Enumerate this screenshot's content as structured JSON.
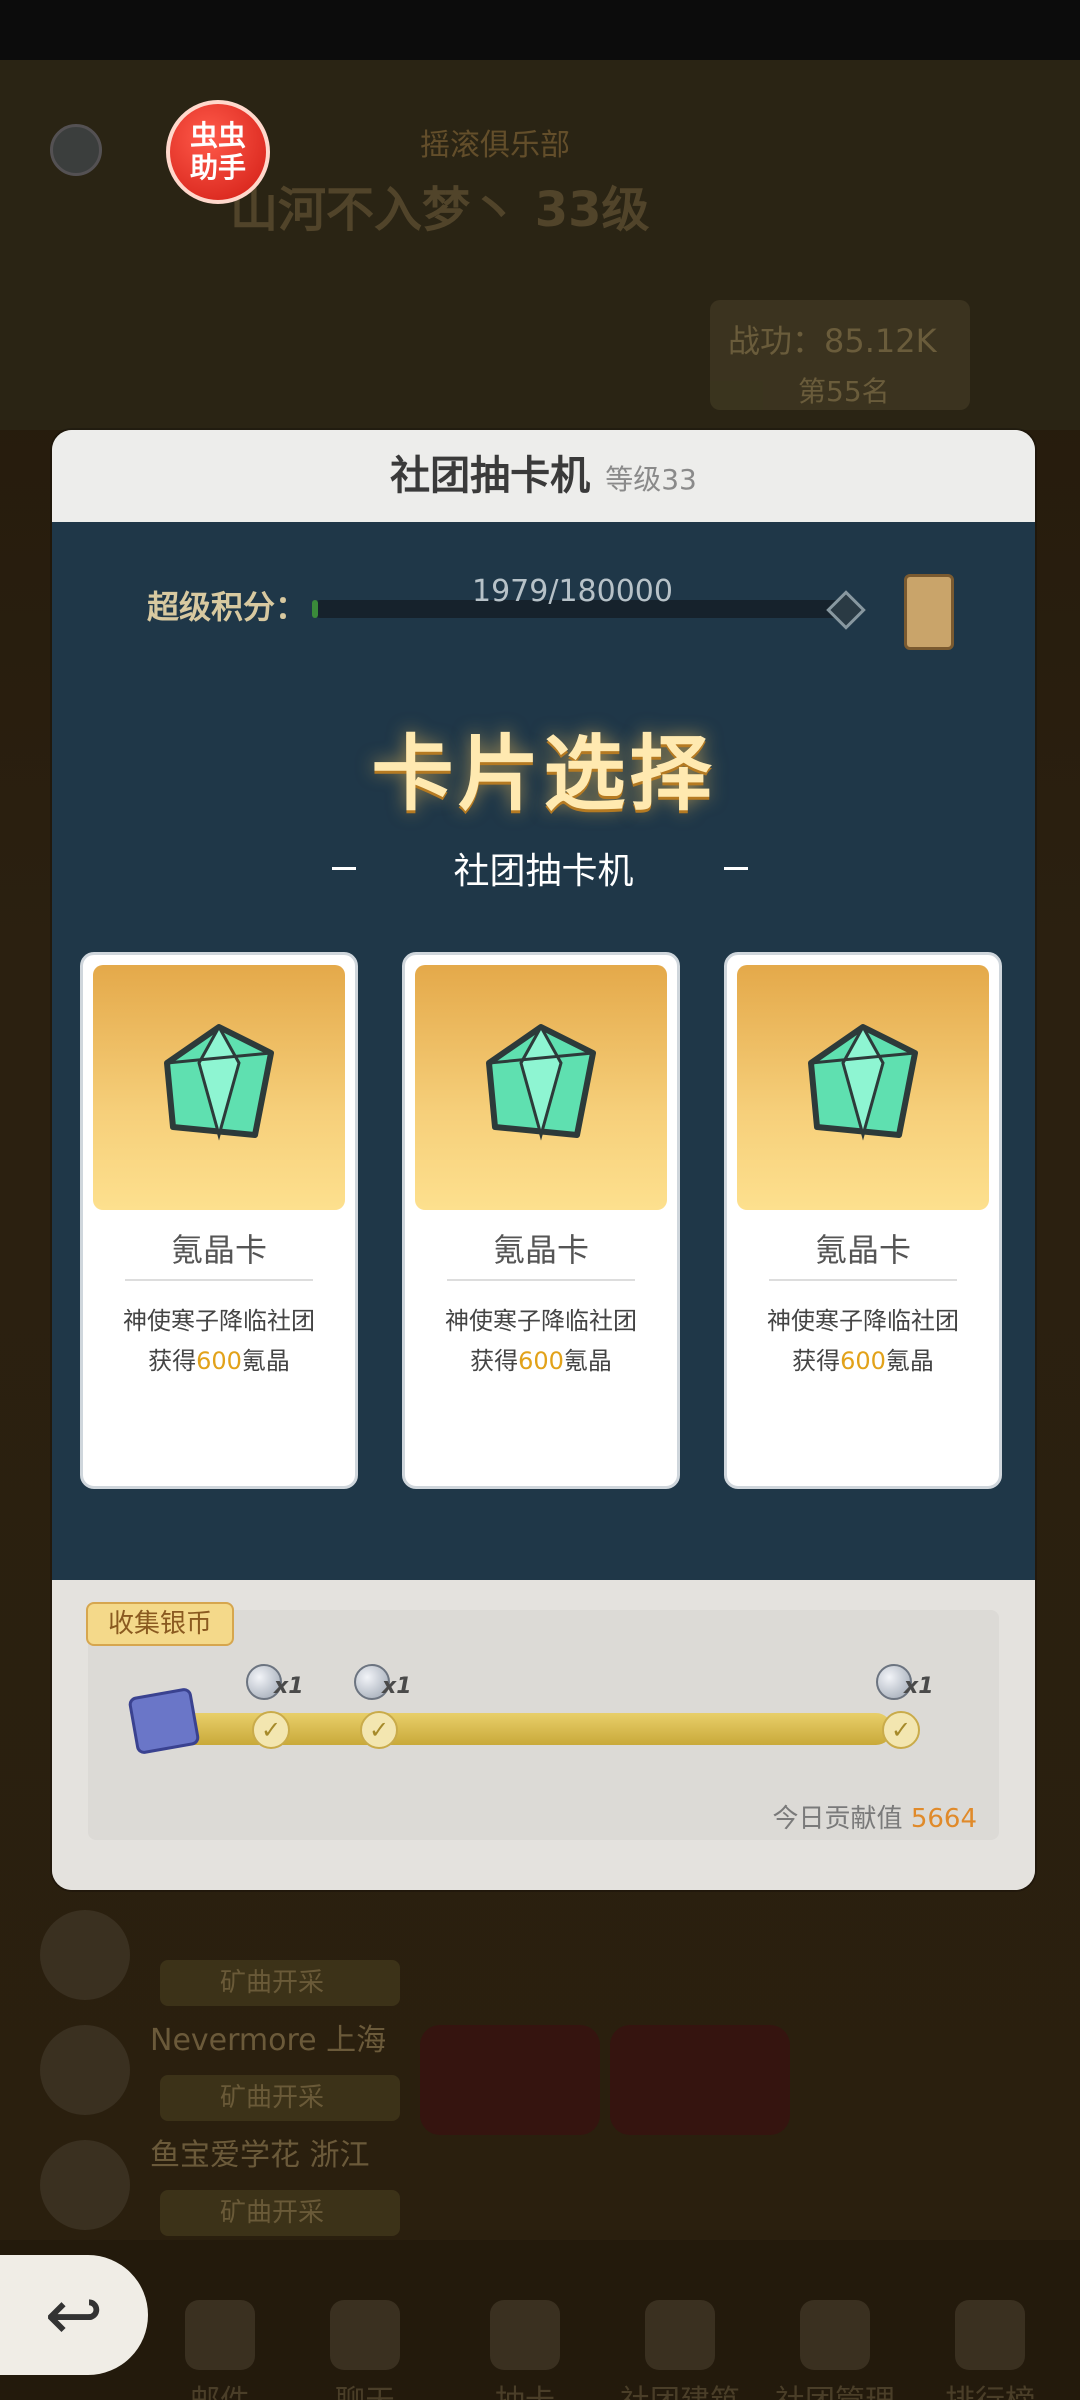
{
  "background": {
    "helper_badge": "虫虫\n助手",
    "club_name": "摇滚俱乐部",
    "player_line": "山河不入梦丶 33级",
    "power_label": "战功：85.12K",
    "rank_label": "第55名",
    "list_rows": [
      {
        "name": "",
        "btn": "矿曲开采"
      },
      {
        "name": "Nevermore 上海",
        "btn": "矿曲开采"
      },
      {
        "name": "鱼宝爱学花 浙江",
        "btn": "矿曲开采"
      }
    ]
  },
  "nav": {
    "back_icon": "↩",
    "items": [
      "邮件",
      "聊天",
      "抽卡",
      "社团建筑",
      "社团管理",
      "排行榜"
    ]
  },
  "modal": {
    "title": "社团抽卡机",
    "level": "等级33",
    "score_label": "超级积分：",
    "score_value": "1979/180000",
    "score_progress": 0.011,
    "big_title": "卡片选择",
    "subtitle": "社团抽卡机",
    "cards": [
      {
        "name": "氪晶卡",
        "desc_line1": "神使寒子降临社团",
        "desc_prefix": "获得",
        "amount": "600",
        "desc_suffix": "氪晶"
      },
      {
        "name": "氪晶卡",
        "desc_line1": "神使寒子降临社团",
        "desc_prefix": "获得",
        "amount": "600",
        "desc_suffix": "氪晶"
      },
      {
        "name": "氪晶卡",
        "desc_line1": "神使寒子降临社团",
        "desc_prefix": "获得",
        "amount": "600",
        "desc_suffix": "氪晶"
      }
    ],
    "collect": {
      "tag": "收集银币",
      "rewards": [
        "x1",
        "x1",
        "x1"
      ],
      "contrib_label": "今日贡献值",
      "contrib_value": "5664"
    }
  },
  "colors": {
    "panel_dark": "#1f3748",
    "title_gold": "#ffe9b0",
    "amount_gold": "#e2a21a",
    "contrib_orange": "#e08a2a"
  }
}
